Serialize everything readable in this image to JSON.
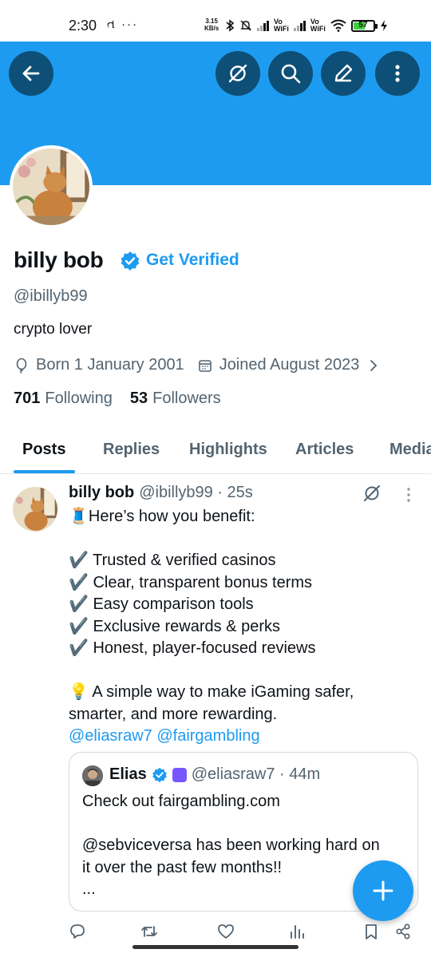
{
  "status_bar": {
    "time": "2:30",
    "left_icons": "ત ···",
    "speed_value": "3.15",
    "speed_unit": "KB/s",
    "vowifi_1": "Vo\nWiFi",
    "vowifi_2": "Vo\nWiFi",
    "battery_level": "57",
    "battery_fraction": 0.57
  },
  "banner": {
    "color": "#1d9bf0",
    "buttons": [
      "back-arrow-icon",
      "grok-icon",
      "search-icon",
      "edit-icon",
      "more-vertical-icon"
    ]
  },
  "profile": {
    "name": "billy bob",
    "get_verified": "Get Verified",
    "handle": "@ibillyb99",
    "bio": "crypto lover",
    "born": "Born 1 January 2001",
    "joined": "Joined August 2023",
    "following_count": "701",
    "following_label": "Following",
    "followers_count": "53",
    "followers_label": "Followers"
  },
  "tabs": [
    "Posts",
    "Replies",
    "Highlights",
    "Articles",
    "Media"
  ],
  "active_tab": "Posts",
  "post": {
    "author": "billy bob",
    "meta": "@ibillyb99 · 25s",
    "lines": [
      "🧵Here’s how you benefit:",
      "",
      "✔️ Trusted & verified casinos",
      "✔️ Clear, transparent bonus terms",
      "✔️ Easy comparison tools",
      "✔️ Exclusive rewards & perks",
      "✔️ Honest, player-focused reviews",
      "",
      "💡 A simple way to make iGaming safer,",
      "smarter, and more rewarding."
    ],
    "mentions": "@eliasraw7 @fairgambling",
    "quote": {
      "author": "Elias",
      "meta": "@eliasraw7 · 44m",
      "lines": [
        "Check out fairgambling.com",
        "",
        "@sebviceversa has been working hard on",
        "it over the past few months!!",
        "..."
      ]
    }
  },
  "colors": {
    "accent": "#1d9bf0",
    "banner_button": "#0e4f77",
    "secondary_text": "#536471"
  }
}
